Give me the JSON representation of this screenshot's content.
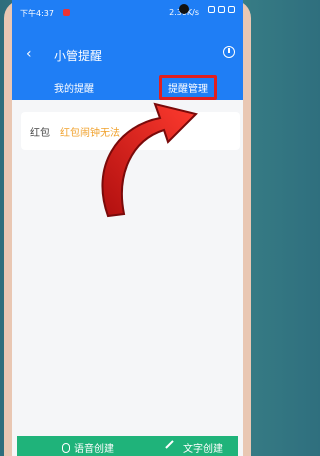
{
  "status_bar": {
    "time": "下午4:37",
    "network_speed": "2.30K/s"
  },
  "app_bar": {
    "back_icon": "chevron-left-icon",
    "title": "小管提醒",
    "history_icon": "clock-icon"
  },
  "tabs": [
    {
      "label": "我的提醒"
    },
    {
      "label": "提醒管理"
    }
  ],
  "reminder_card": {
    "label": "红包",
    "description": "红包闹钟无法"
  },
  "overlay": {
    "arrow_color": "#d91c1c"
  },
  "bottom_bar": {
    "voice_label": "语音创建",
    "text_label": "文字创建",
    "voice_icon": "mic-icon",
    "text_icon": "pen-icon"
  },
  "colors": {
    "primary": "#1f7ef5",
    "accent_green": "#1fb37a",
    "highlight_red": "#e01f1f",
    "warning_text": "#f0a12c"
  }
}
